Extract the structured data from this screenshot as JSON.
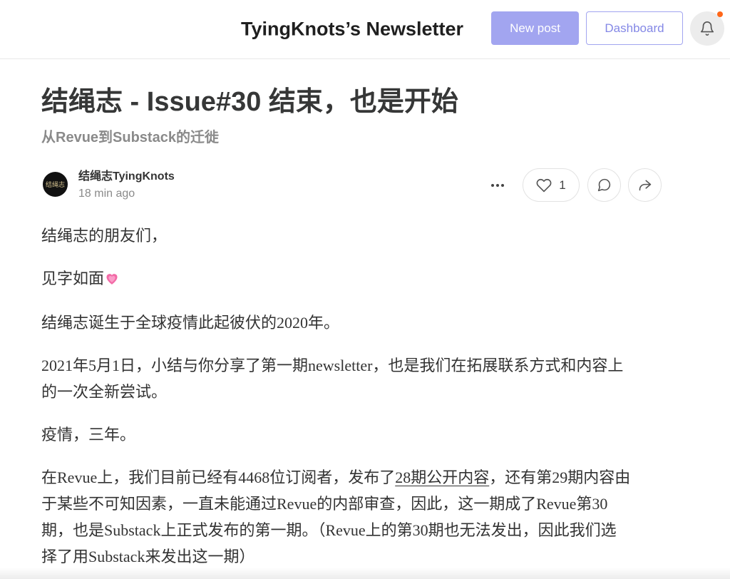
{
  "colors": {
    "accent": "#a2a5f0",
    "accent_text": "#8488e6",
    "notification_dot": "#ff6719",
    "body_text": "#333333",
    "muted_text": "#8a8a8a"
  },
  "header": {
    "publication_title": "TyingKnots’s Newsletter",
    "new_post_label": "New post",
    "dashboard_label": "Dashboard",
    "notification_icon": "bell-icon"
  },
  "post": {
    "title": "结绳志 - Issue#30 结束，也是开始",
    "subtitle": "从Revue到Substack的迁徙",
    "author": {
      "avatar_logo_text": "结绳志",
      "name": "结绳志TyingKnots",
      "published": "18 min ago"
    },
    "actions": {
      "more_icon": "more-horizontal-icon",
      "like_icon": "heart-icon",
      "like_count": "1",
      "comment_icon": "comment-icon",
      "share_icon": "share-icon"
    },
    "body": [
      {
        "lines": [
          "结绳志的朋友们，"
        ]
      },
      {
        "lines": [
          "见字如面"
        ],
        "emoji_icon": "pink-heart-emoji-icon"
      },
      {
        "lines": [
          "结绳志诞生于全球疫情此起彼伏的2020年。"
        ]
      },
      {
        "lines": [
          "2021年5月1日，小结与你分享了第一期newsletter，也是我们在拓展联系方式和内容上",
          "的一次全新尝试。"
        ]
      },
      {
        "lines": [
          "疫情，三年。"
        ]
      },
      {
        "lines": [
          {
            "before": "在Revue上，我们目前已经有4468位订阅者，发布了",
            "link": "28期公开内容",
            "after": "，还有第29期内容由"
          },
          "于某些不可知因素，一直未能通过Revue的内部审查，因此，这一期成了Revue第30",
          "期，也是Substack上正式发布的第一期。（Revue上的第30期也无法发出，因此我们选",
          "择了用Substack来发出这一期）"
        ]
      }
    ]
  }
}
